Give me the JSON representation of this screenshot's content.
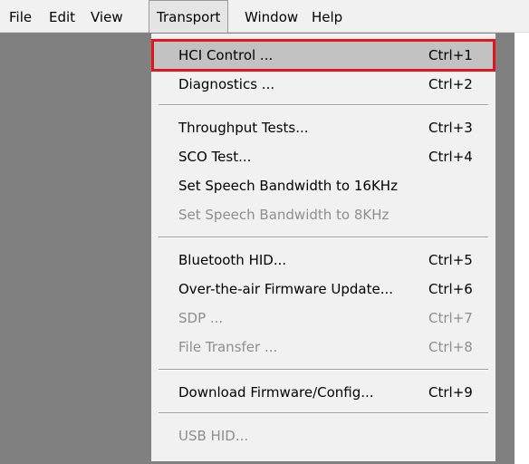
{
  "menubar": {
    "items": [
      {
        "label": "File"
      },
      {
        "label": "Edit"
      },
      {
        "label": "View"
      },
      {
        "label": "Transport"
      },
      {
        "label": "Window"
      },
      {
        "label": "Help"
      }
    ]
  },
  "transport_menu": {
    "items": [
      {
        "label": "HCI Control ...",
        "shortcut": "Ctrl+1"
      },
      {
        "label": "Diagnostics ...",
        "shortcut": "Ctrl+2"
      },
      {
        "label": "Throughput Tests...",
        "shortcut": "Ctrl+3"
      },
      {
        "label": "SCO Test...",
        "shortcut": "Ctrl+4"
      },
      {
        "label": "Set Speech Bandwidth to 16KHz",
        "shortcut": ""
      },
      {
        "label": "Set Speech Bandwidth to 8KHz",
        "shortcut": ""
      },
      {
        "label": "Bluetooth HID...",
        "shortcut": "Ctrl+5"
      },
      {
        "label": "Over-the-air Firmware Update...",
        "shortcut": "Ctrl+6"
      },
      {
        "label": "SDP ...",
        "shortcut": "Ctrl+7"
      },
      {
        "label": "File Transfer ...",
        "shortcut": "Ctrl+8"
      },
      {
        "label": "Download Firmware/Config...",
        "shortcut": "Ctrl+9"
      },
      {
        "label": "USB HID...",
        "shortcut": ""
      }
    ]
  },
  "colors": {
    "highlight_box": "#e3141b",
    "disabled_text": "#8e8e8e",
    "background_panel": "#808080"
  }
}
